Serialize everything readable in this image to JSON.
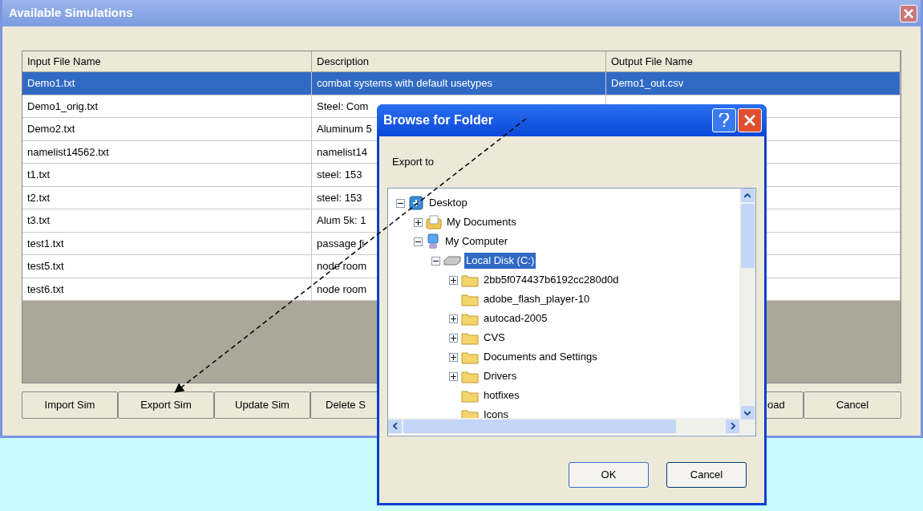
{
  "window": {
    "title": "Available Simulations"
  },
  "table": {
    "columns": [
      "Input File Name",
      "Description",
      "Output File Name"
    ],
    "rows": [
      {
        "cells": [
          "Demo1.txt",
          "combat systems with default usetypes",
          "Demo1_out.csv"
        ],
        "selected": true
      },
      {
        "cells": [
          "Demo1_orig.txt",
          "Steel: Com"
        ],
        "selected": false
      },
      {
        "cells": [
          "Demo2.txt",
          "Aluminum 5"
        ],
        "selected": false
      },
      {
        "cells": [
          "namelist14562.txt",
          "namelist14"
        ],
        "selected": false
      },
      {
        "cells": [
          "t1.txt",
          "steel: 153"
        ],
        "selected": false
      },
      {
        "cells": [
          "t2.txt",
          "steel: 153"
        ],
        "selected": false
      },
      {
        "cells": [
          "t3.txt",
          "Alum 5k: 1"
        ],
        "selected": false
      },
      {
        "cells": [
          "test1.txt",
          "passage fi"
        ],
        "selected": false
      },
      {
        "cells": [
          "test5.txt",
          "node room"
        ],
        "selected": false
      },
      {
        "cells": [
          "test6.txt",
          "node room"
        ],
        "selected": false
      }
    ]
  },
  "buttons_left": [
    "Import Sim",
    "Export Sim",
    "Update Sim",
    "Delete S"
  ],
  "buttons_right": [
    "oad",
    "Cancel"
  ],
  "dialog": {
    "title": "Browse for Folder",
    "prompt": "Export to",
    "tree": [
      {
        "label": "Desktop",
        "kind": "desktop",
        "expanded": true,
        "selected": false,
        "children": [
          {
            "label": "My Documents",
            "kind": "documents",
            "expanded": false,
            "selected": false
          },
          {
            "label": "My Computer",
            "kind": "computer",
            "expanded": true,
            "selected": false,
            "children": [
              {
                "label": "Local Disk (C:)",
                "kind": "drive",
                "expanded": true,
                "selected": true,
                "children": [
                  {
                    "label": "2bb5f074437b6192cc280d0d",
                    "kind": "folder",
                    "expanded": false,
                    "selected": false
                  },
                  {
                    "label": "adobe_flash_player-10",
                    "kind": "folder",
                    "selected": false
                  },
                  {
                    "label": "autocad-2005",
                    "kind": "folder",
                    "expanded": false,
                    "selected": false
                  },
                  {
                    "label": "CVS",
                    "kind": "folder",
                    "expanded": false,
                    "selected": false
                  },
                  {
                    "label": "Documents and Settings",
                    "kind": "folder",
                    "expanded": false,
                    "selected": false
                  },
                  {
                    "label": "Drivers",
                    "kind": "folder",
                    "expanded": false,
                    "selected": false
                  },
                  {
                    "label": "hotfixes",
                    "kind": "folder",
                    "selected": false
                  },
                  {
                    "label": "Icons",
                    "kind": "folder",
                    "selected": false
                  }
                ]
              }
            ]
          }
        ]
      }
    ],
    "buttons": [
      "OK",
      "Cancel"
    ]
  }
}
